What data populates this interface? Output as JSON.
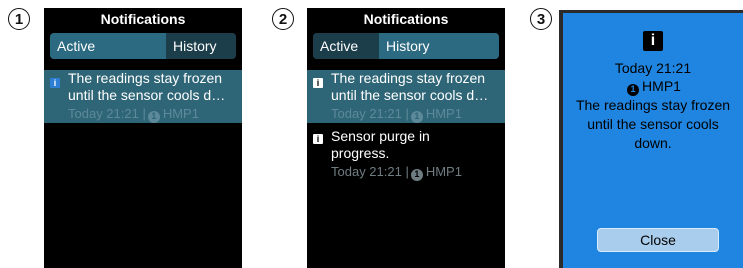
{
  "steps": [
    "1",
    "2",
    "3"
  ],
  "header": {
    "title": "Notifications"
  },
  "tabs": {
    "active": "Active",
    "history": "History"
  },
  "notification_1": {
    "line1": "The readings stay frozen",
    "line2": "until the sensor cools d…",
    "time": "Today 21:21 |",
    "device_number": "1",
    "device": "HMP1"
  },
  "notification_2": {
    "line1": "Sensor purge in",
    "line2": "progress.",
    "time": "Today 21:21 |",
    "device_number": "1",
    "device": "HMP1"
  },
  "icon_glyph": "i",
  "detail": {
    "time": "Today 21:21",
    "device_number": "1",
    "device": "HMP1",
    "line1": "The readings stay frozen",
    "line2": "until the sensor cools",
    "line3": "down.",
    "close_label": "Close"
  },
  "colors": {
    "screen_bg": "#000000",
    "tab_selected": "#2b6a80",
    "tab_unselected": "#1c3d4a",
    "highlight_row": "#2e6577",
    "info_icon_blue": "#2d7fd5",
    "modal_bg": "#2085e0",
    "close_button": "#a9cdec"
  }
}
